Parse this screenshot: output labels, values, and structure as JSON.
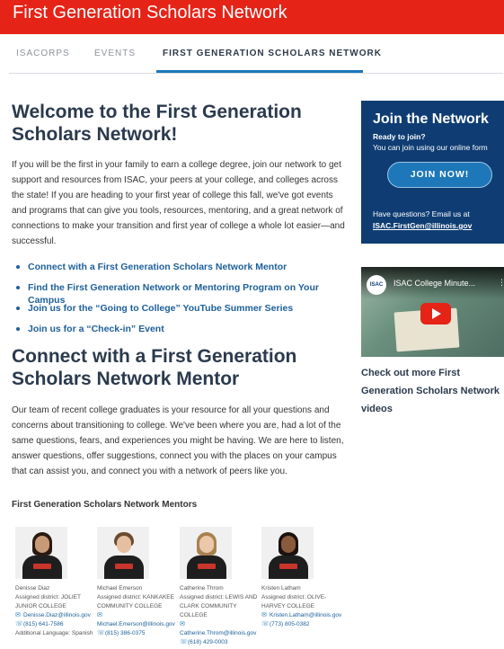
{
  "header": {
    "title": "First Generation Scholars Network"
  },
  "tabs": [
    {
      "label": "ISACORPS"
    },
    {
      "label": "EVENTS"
    },
    {
      "label": "FIRST GENERATION SCHOLARS NETWORK",
      "active": true
    }
  ],
  "intro": {
    "heading": "Welcome to the First Generation Scholars Network!",
    "paragraph": "If you will be the first in your family to earn a college degree, join our network to get support and resources from ISAC, your peers at your college, and colleges across the state! If you are heading to your first year of college this fall, we've got events and programs that can give you tools, resources, mentoring, and a great network of connections to make your transition and first year of college a whole lot easier—and successful."
  },
  "links": [
    "Connect with a First Generation Scholars Network Mentor",
    "Find the First Generation Network or Mentoring Program on Your Campus",
    "Join us for the “Going to College” YouTube Summer Series",
    "Join us for a “Check-in” Event"
  ],
  "mentor_section": {
    "heading": "Connect with a First Generation Scholars Network Mentor",
    "paragraph": "Our team of recent college graduates is your resource for all your questions and concerns about transitioning to college. We've been where you are, had a lot of the same questions, fears, and experiences you might be having. We are here to listen, answer questions, offer suggestions, connect you with the places on your campus that can assist you, and connect you with a network of peers like you.",
    "list_title": "First Generation Scholars Network Mentors"
  },
  "mentors": [
    {
      "name": "Denisse Diaz",
      "district": "Assigned district: JOLIET JUNIOR COLLEGE",
      "email": "Denisse.Diaz@illinois.gov",
      "phone": "(815) 641-7586",
      "extra": "Additional Language: Spanish",
      "hair": "#2a1a12",
      "skin": "#c99a78"
    },
    {
      "name": "Michael Emerson",
      "district": "Assigned district: KANKAKEE COMMUNITY COLLEGE",
      "email": "Michael.Emerson@illinois.gov",
      "phone": "(815) 386-0375",
      "extra": "",
      "hair": "#6b4a2e",
      "skin": "#e5bfa0"
    },
    {
      "name": "Catherine Throm",
      "district": "Assigned district: LEWIS AND CLARK COMMUNITY COLLEGE",
      "email": "Catherine.Throm@illinois.gov",
      "phone": "(618) 429-0003",
      "extra": "",
      "hair": "#a8814f",
      "skin": "#ecc8aa"
    },
    {
      "name": "Kristen Latham",
      "district": "Assigned district: OLIVE-HARVEY COLLEGE",
      "email": "Kristen.Latham@illinois.gov",
      "phone": "(773) 805-0382",
      "extra": "",
      "hair": "#1b1110",
      "skin": "#8a5a3c"
    }
  ],
  "sidebar": {
    "join_title": "Join the Network",
    "ready": "Ready to join?",
    "online": "You can join using our online form",
    "button": "JOIN NOW!",
    "questions": "Have questions? Email us at",
    "email": "ISAC.FirstGen@illinois.gov",
    "video_logo": "ISAC",
    "video_title": "ISAC College Minute...",
    "video_caption": "Check out more First Generation Scholars Network videos"
  }
}
